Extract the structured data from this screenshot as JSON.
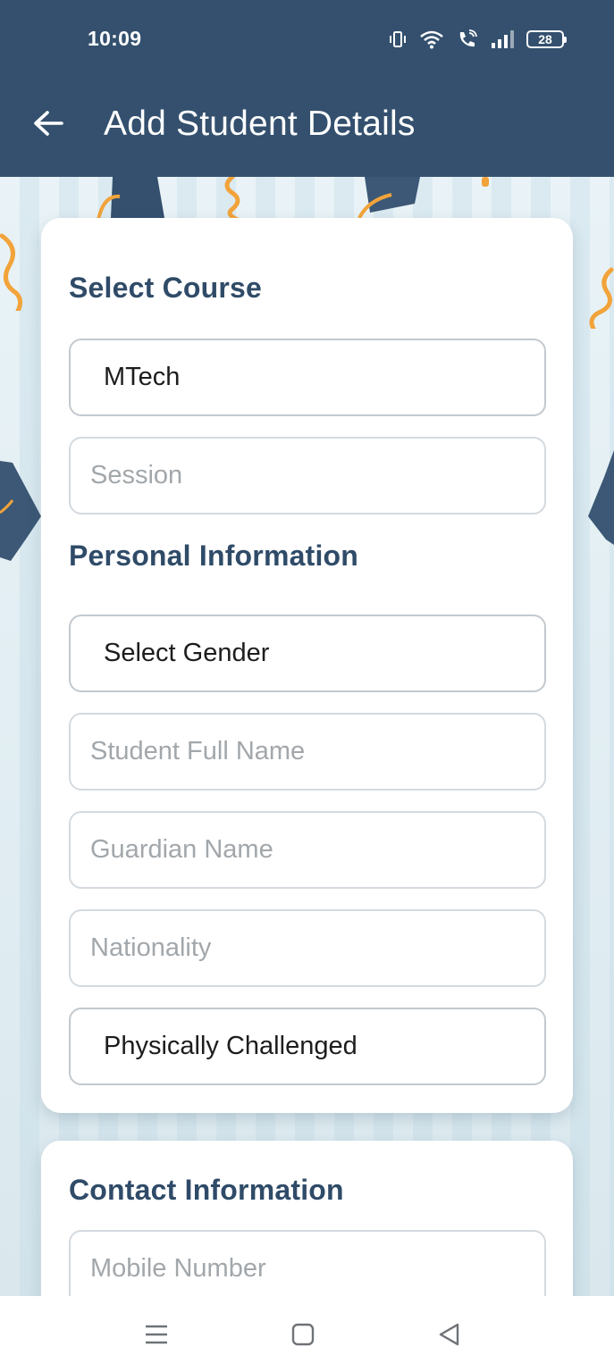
{
  "status_bar": {
    "time": "10:09",
    "battery_level": "28",
    "icons": [
      "vibrate-icon",
      "wifi-icon",
      "wifi-calling-icon",
      "signal-icon",
      "battery-icon"
    ]
  },
  "app_bar": {
    "title": "Add Student Details",
    "back_icon": "arrow-left-icon"
  },
  "colors": {
    "primary": "#34506e",
    "heading": "#2f4b68",
    "accent_confetti": "#f2a33a",
    "placeholder": "#a2a7ab"
  },
  "course_section": {
    "title": "Select Course",
    "course_select": {
      "value": "MTech"
    },
    "session_input": {
      "placeholder": "Session"
    }
  },
  "personal_section": {
    "title": "Personal Information",
    "gender_select": {
      "value": "Select Gender"
    },
    "full_name_input": {
      "placeholder": "Student Full Name"
    },
    "guardian_input": {
      "placeholder": "Guardian Name"
    },
    "nationality_input": {
      "placeholder": "Nationality"
    },
    "physically_challenged_select": {
      "value": "Physically Challenged"
    }
  },
  "contact_section": {
    "title": "Contact Information",
    "mobile_input": {
      "placeholder": "Mobile Number"
    }
  },
  "nav_bar": {
    "icons": [
      "menu-icon",
      "home-square-icon",
      "back-triangle-icon"
    ]
  }
}
